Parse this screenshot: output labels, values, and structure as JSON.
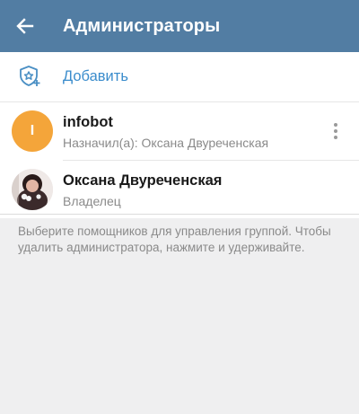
{
  "header": {
    "title": "Администраторы",
    "back_icon": "arrow-left-icon",
    "background_color": "#527da3"
  },
  "add": {
    "label": "Добавить",
    "icon": "shield-add-icon",
    "color": "#3a8ccc"
  },
  "admins": [
    {
      "name": "infobot",
      "subtitle": "Назначил(а): Оксана Двуреченская",
      "avatar_letter": "I",
      "avatar_color": "#f4a53a",
      "menu_icon": "more-vertical-icon"
    },
    {
      "name": "Оксана Двуреченская",
      "subtitle": "Владелец",
      "avatar_icon": "user-photo"
    }
  ],
  "hint": "Выберите помощников для управления группой. Чтобы удалить администратора, нажмите и удерживайте."
}
